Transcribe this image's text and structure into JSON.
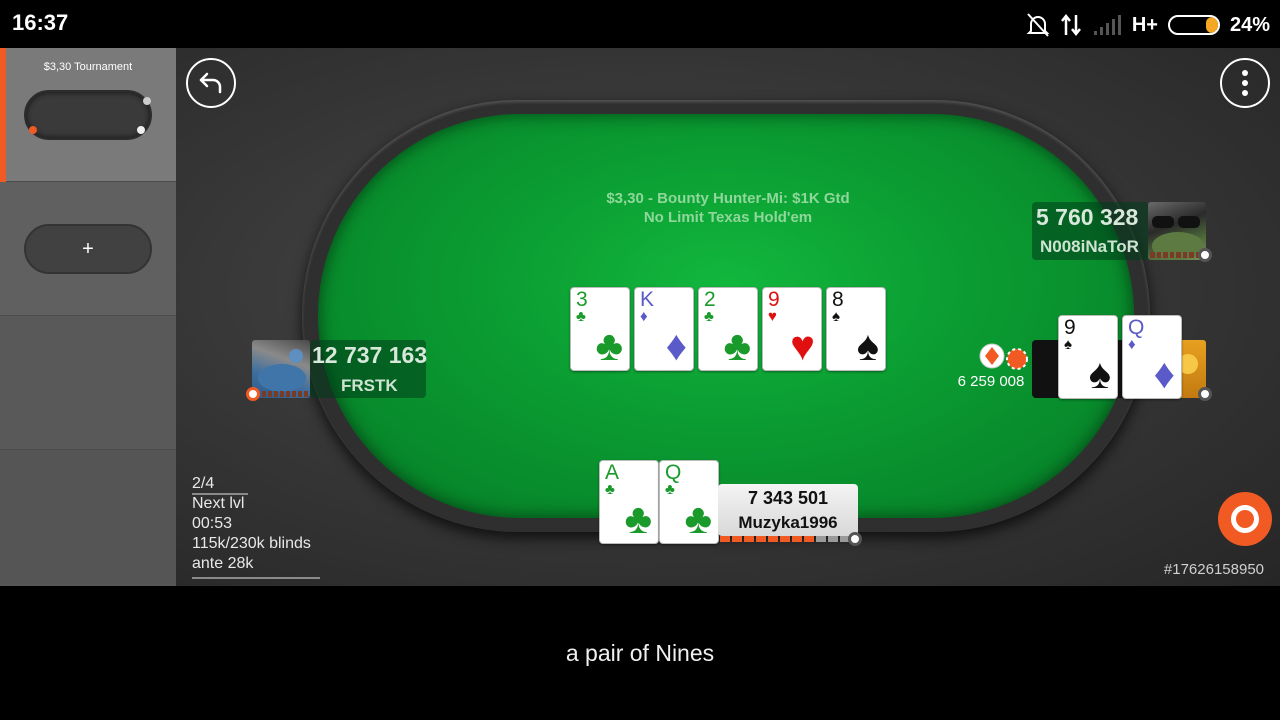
{
  "status_bar": {
    "time": "16:37",
    "network": "H+",
    "battery_percent": "24%",
    "battery_level": 0.24
  },
  "sidebar": {
    "active_table": {
      "title": "$3,30 Tournament"
    },
    "add_table": {
      "label": "+"
    }
  },
  "table": {
    "info_line1": "$3,30 - Bounty Hunter-Mi: $1K Gtd",
    "info_line2": "No Limit Texas Hold'em",
    "board": [
      {
        "rank": "3",
        "suit": "♣",
        "color": "#1a9a2a"
      },
      {
        "rank": "K",
        "suit": "♦",
        "color": "#5a5ac8"
      },
      {
        "rank": "2",
        "suit": "♣",
        "color": "#1a9a2a"
      },
      {
        "rank": "9",
        "suit": "♥",
        "color": "#e01010"
      },
      {
        "rank": "8",
        "suit": "♠",
        "color": "#111111"
      }
    ]
  },
  "players": {
    "top_right": {
      "stack": "5 760 328",
      "name": "N008iNaToR"
    },
    "left": {
      "stack": "12 737 163",
      "name": "FRSTK"
    },
    "right": {
      "bet": "6 259 008",
      "cards": [
        {
          "rank": "9",
          "suit": "♠",
          "color": "#111111"
        },
        {
          "rank": "Q",
          "suit": "♦",
          "color": "#5a5ac8"
        }
      ]
    }
  },
  "hero": {
    "stack": "7 343 501",
    "name": "Muzyka1996",
    "time_remaining": 0.7,
    "cards": [
      {
        "rank": "A",
        "suit": "♣",
        "color": "#1a9a2a"
      },
      {
        "rank": "Q",
        "suit": "♣",
        "color": "#1a9a2a"
      }
    ]
  },
  "level_info": {
    "position": "2/4",
    "next_level_label": "Next lvl",
    "next_level_time": "00:53",
    "blinds": "115k/230k blinds",
    "ante": "ante 28k"
  },
  "hand_id": "#17626158950",
  "hand_description": "a pair of Nines",
  "colors": {
    "accent": "#f15a22",
    "felt": "#0a9a31",
    "timer": "#f15a22"
  }
}
